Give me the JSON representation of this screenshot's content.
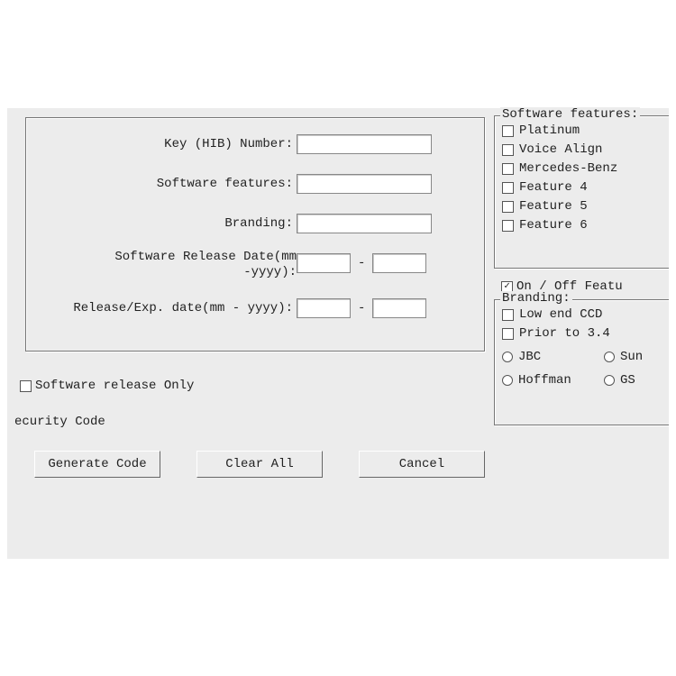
{
  "form": {
    "key_label": "Key (HIB) Number:",
    "features_label": "Software features:",
    "branding_label": "Branding:",
    "release_date_label_l1": "Software Release Date(mm",
    "release_date_label_l2": "-yyyy):",
    "exp_date_label": "Release/Exp. date(mm - yyyy):",
    "dash": "-"
  },
  "sw_only": "Software release Only",
  "security_code": "ecurity Code",
  "buttons": {
    "generate": "Generate Code",
    "clear": "Clear All",
    "cancel": "Cancel"
  },
  "features_group": {
    "title": "Software features:",
    "items": [
      "Platinum",
      "Voice Align",
      "Mercedes-Benz",
      "Feature 4",
      "Feature 5",
      "Feature 6"
    ]
  },
  "onoff": {
    "label": "On / Off Featu",
    "checked": true,
    "mark": "✓"
  },
  "branding_group": {
    "title": "Branding:",
    "low_end": "Low end CCD",
    "prior": "Prior to 3.4",
    "jbc": "JBC",
    "sun": "Sun",
    "hoffman": "Hoffman",
    "gs": "GS"
  }
}
